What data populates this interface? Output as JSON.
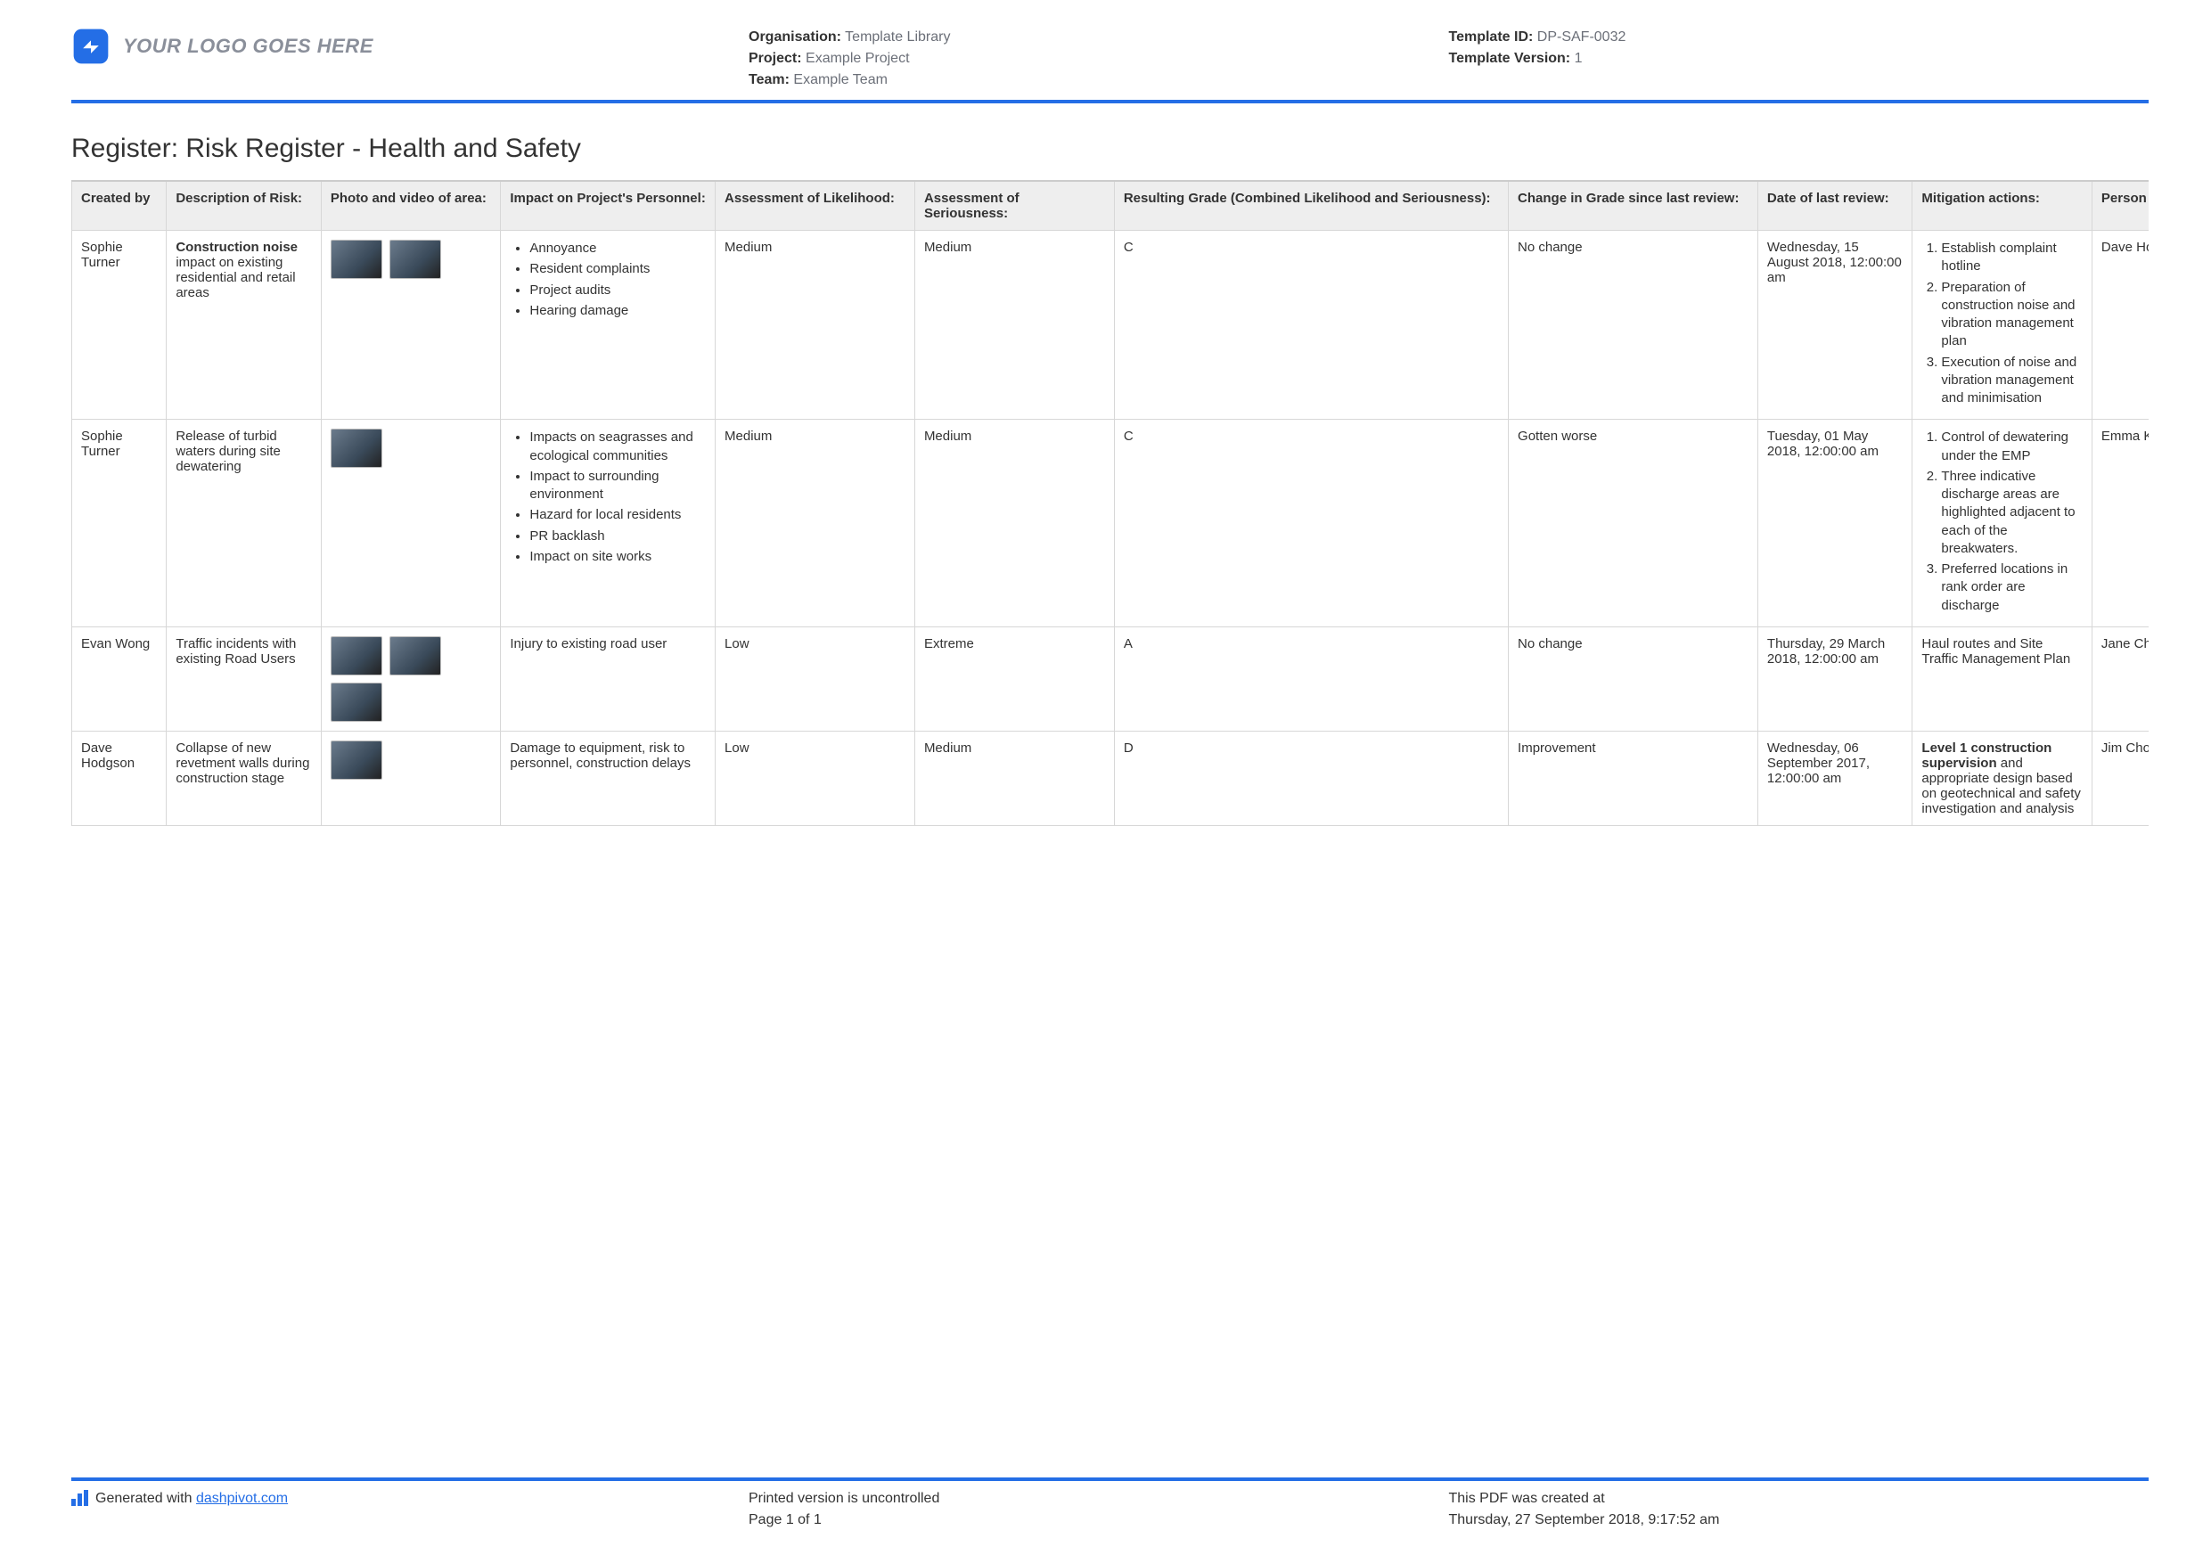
{
  "logo_text": "YOUR LOGO GOES HERE",
  "meta": {
    "organisation_label": "Organisation:",
    "organisation_value": "Template Library",
    "project_label": "Project:",
    "project_value": "Example Project",
    "team_label": "Team:",
    "team_value": "Example Team",
    "template_id_label": "Template ID:",
    "template_id_value": "DP-SAF-0032",
    "template_version_label": "Template Version:",
    "template_version_value": "1"
  },
  "title": "Register: Risk Register - Health and Safety",
  "columns": [
    "Created by",
    "Description of Risk:",
    "Photo and video of area:",
    "Impact on Project's Personnel:",
    "Assessment of Likelihood:",
    "Assessment of Seriousness:",
    "Resulting Grade (Combined Likelihood and Seriousness):",
    "Change in Grade since last review:",
    "Date of last review:",
    "Mitigation actions:",
    "Person re"
  ],
  "rows": [
    {
      "created_by": "Sophie Turner",
      "description_bold": "Construction noise",
      "description_rest": " impact on existing residential and retail areas",
      "thumbs": 2,
      "impact_list": [
        "Annoyance",
        "Resident complaints",
        "Project audits",
        "Hearing damage"
      ],
      "likelihood": "Medium",
      "seriousness": "Medium",
      "grade": "C",
      "change": "No change",
      "last_review": "Wednesday, 15 August 2018, 12:00:00 am",
      "mitigation_list": [
        "Establish complaint hotline",
        "Preparation of construction noise and vibration management plan",
        "Execution of noise and vibration management and minimisation"
      ],
      "person": "Dave Hole"
    },
    {
      "created_by": "Sophie Turner",
      "description_bold": "",
      "description_rest": "Release of turbid waters during site dewatering",
      "thumbs": 1,
      "impact_list": [
        "Impacts on seagrasses and ecological communities",
        "Impact to surrounding environment",
        "Hazard for local residents",
        "PR backlash",
        "Impact on site works"
      ],
      "likelihood": "Medium",
      "seriousness": "Medium",
      "grade": "C",
      "change": "Gotten worse",
      "last_review": "Tuesday, 01 May 2018, 12:00:00 am",
      "mitigation_list": [
        "Control of dewatering under the EMP",
        "Three indicative discharge areas are highlighted adjacent to each of the breakwaters.",
        "Preferred locations in rank order are discharge"
      ],
      "person": "Emma Kitt"
    },
    {
      "created_by": "Evan Wong",
      "description_bold": "",
      "description_rest": "Traffic incidents with existing Road Users",
      "thumbs": 3,
      "impact_text": "Injury to existing road user",
      "likelihood": "Low",
      "seriousness": "Extreme",
      "grade": "A",
      "change": "No change",
      "last_review": "Thursday, 29 March 2018, 12:00:00 am",
      "mitigation_text": "Haul routes and Site Traffic Management Plan",
      "person": "Jane Chefi"
    },
    {
      "created_by": "Dave Hodgson",
      "description_bold": "",
      "description_rest": "Collapse of new revetment walls during construction stage",
      "thumbs": 1,
      "impact_text": "Damage to equipment, risk to personnel, construction delays",
      "likelihood": "Low",
      "seriousness": "Medium",
      "grade": "D",
      "change": "Improvement",
      "last_review": "Wednesday, 06 September 2017, 12:00:00 am",
      "mitigation_bold": "Level 1 construction supervision",
      "mitigation_rest": " and appropriate design based on geotechnical and safety investigation and analysis",
      "person": "Jim Choote"
    }
  ],
  "footer": {
    "generated_prefix": "Generated with ",
    "generated_link": "dashpivot.com",
    "uncontrolled": "Printed version is uncontrolled",
    "page": "Page 1 of 1",
    "created_label": "This PDF was created at",
    "created_value": "Thursday, 27 September 2018, 9:17:52 am"
  }
}
